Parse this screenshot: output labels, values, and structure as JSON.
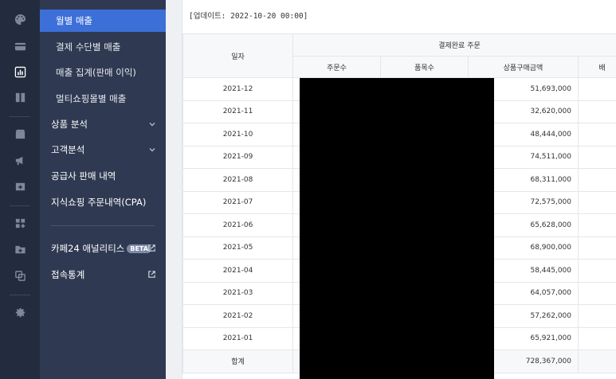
{
  "rail": {
    "icons": [
      "palette-icon",
      "card-icon",
      "chart-icon",
      "book-icon",
      "box-icon",
      "megaphone-icon",
      "cart-plus-icon",
      "apps-icon",
      "folder-plus-icon",
      "copy-icon",
      "gear-icon"
    ],
    "active": "chart-icon"
  },
  "submenu": {
    "items": [
      {
        "label": "월별 매출",
        "type": "child",
        "active": true
      },
      {
        "label": "결제 수단별 매출",
        "type": "child"
      },
      {
        "label": "매출 집계(판매 이익)",
        "type": "child"
      },
      {
        "label": "멀티쇼핑몰별 매출",
        "type": "child"
      },
      {
        "label": "상품 분석",
        "type": "top",
        "chevron": true
      },
      {
        "label": "고객분석",
        "type": "top",
        "chevron": true
      },
      {
        "label": "공급사 판매 내역",
        "type": "top"
      },
      {
        "label": "지식쇼핑 주문내역(CPA)",
        "type": "top"
      }
    ],
    "analytics_label": "카페24 애널리티스",
    "analytics_badge": "BETA",
    "access_label": "접속통계"
  },
  "main": {
    "update_text": "[업데이트: 2022-10-20 00:00]",
    "header": {
      "date_col": "일자",
      "group": "결제완료 주문",
      "order_count": "주문수",
      "item_count": "품목수",
      "amount": "상품구매금액",
      "more": "배"
    },
    "rows": [
      {
        "date": "2021-12",
        "amount": "51,693,000"
      },
      {
        "date": "2021-11",
        "amount": "32,620,000"
      },
      {
        "date": "2021-10",
        "amount": "48,444,000"
      },
      {
        "date": "2021-09",
        "amount": "74,511,000"
      },
      {
        "date": "2021-08",
        "amount": "68,311,000"
      },
      {
        "date": "2021-07",
        "amount": "72,575,000"
      },
      {
        "date": "2021-06",
        "amount": "65,628,000"
      },
      {
        "date": "2021-05",
        "amount": "68,900,000"
      },
      {
        "date": "2021-04",
        "amount": "58,445,000"
      },
      {
        "date": "2021-03",
        "amount": "64,057,000"
      },
      {
        "date": "2021-02",
        "amount": "57,262,000"
      },
      {
        "date": "2021-01",
        "amount": "65,921,000"
      }
    ],
    "total": {
      "label": "합계",
      "amount": "728,367,000"
    }
  }
}
